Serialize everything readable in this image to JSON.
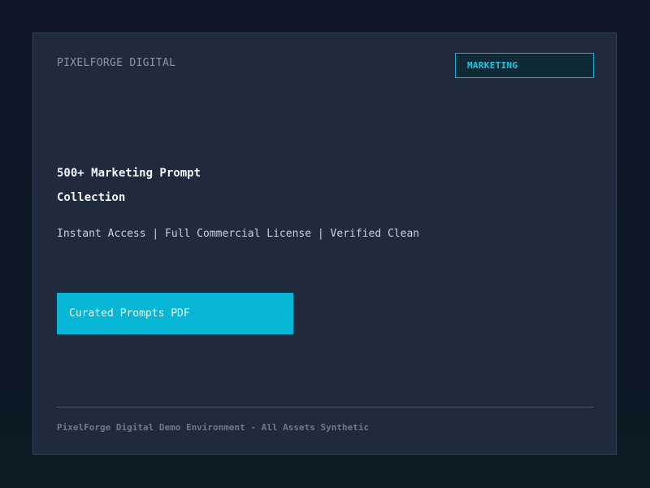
{
  "card": {
    "brand": "PIXELFORGE DIGITAL",
    "category_tag": "MARKETING",
    "title": "500+ Marketing Prompt Collection",
    "features": "Instant Access | Full Commercial License | Verified Clean",
    "cta_label": "Curated Prompts PDF",
    "footer": "PixelForge Digital Demo Environment - All Assets Synthetic"
  },
  "colors": {
    "background": "#0f1729",
    "card": "#1f2a3c",
    "accent": "#06b6d4",
    "tag_text": "#1fc6e6"
  }
}
